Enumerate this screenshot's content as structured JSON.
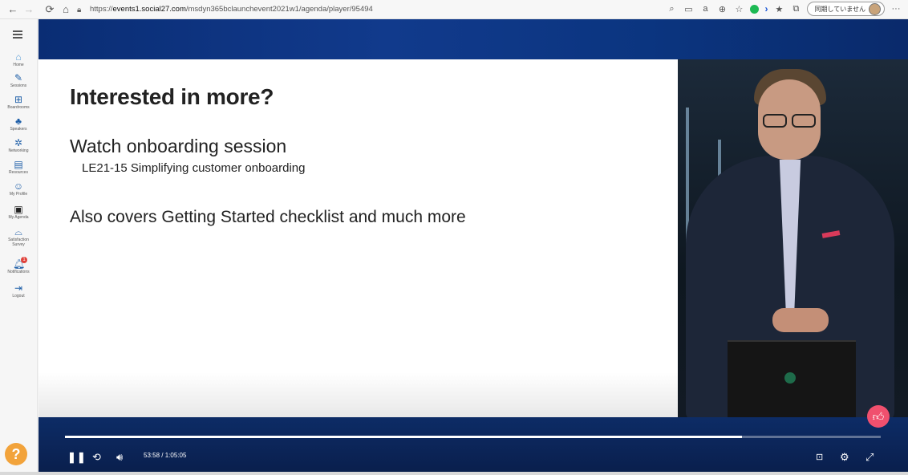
{
  "browser": {
    "url_prefix": "https://",
    "url_host": "events1.social27.com",
    "url_path": "/msdyn365bclaunchevent2021w1/agenda/player/95494",
    "sync_label": "同期していません"
  },
  "sidebar": {
    "items": [
      {
        "label": "Home",
        "icon": "home-icon"
      },
      {
        "label": "Sessions",
        "icon": "pencil-icon"
      },
      {
        "label": "Boardrooms",
        "icon": "boardroom-icon"
      },
      {
        "label": "Speakers",
        "icon": "speaker-icon"
      },
      {
        "label": "Networking",
        "icon": "networking-icon"
      },
      {
        "label": "Resources",
        "icon": "resources-icon"
      },
      {
        "label": "My Profile",
        "icon": "profile-icon"
      },
      {
        "label": "My Agenda",
        "icon": "agenda-icon"
      },
      {
        "label": "Satisfaction Survey",
        "icon": "survey-icon"
      },
      {
        "label": "Notifications",
        "icon": "bell-icon"
      },
      {
        "label": "Logout",
        "icon": "logout-icon"
      }
    ],
    "notification_count": "1",
    "help_label": "?"
  },
  "slide": {
    "title": "Interested in more?",
    "heading": "Watch onboarding session",
    "subheading": "LE21-15 Simplifying customer onboarding",
    "note": "Also covers Getting Started checklist and much more"
  },
  "player": {
    "current_time": "53:58",
    "separator": "/",
    "duration": "1:05:05",
    "progress_fraction": 0.83
  },
  "colors": {
    "accent": "#1f5fa8",
    "like": "#f0506e",
    "help": "#f2a33b",
    "player_bg": "#0b2a66"
  }
}
